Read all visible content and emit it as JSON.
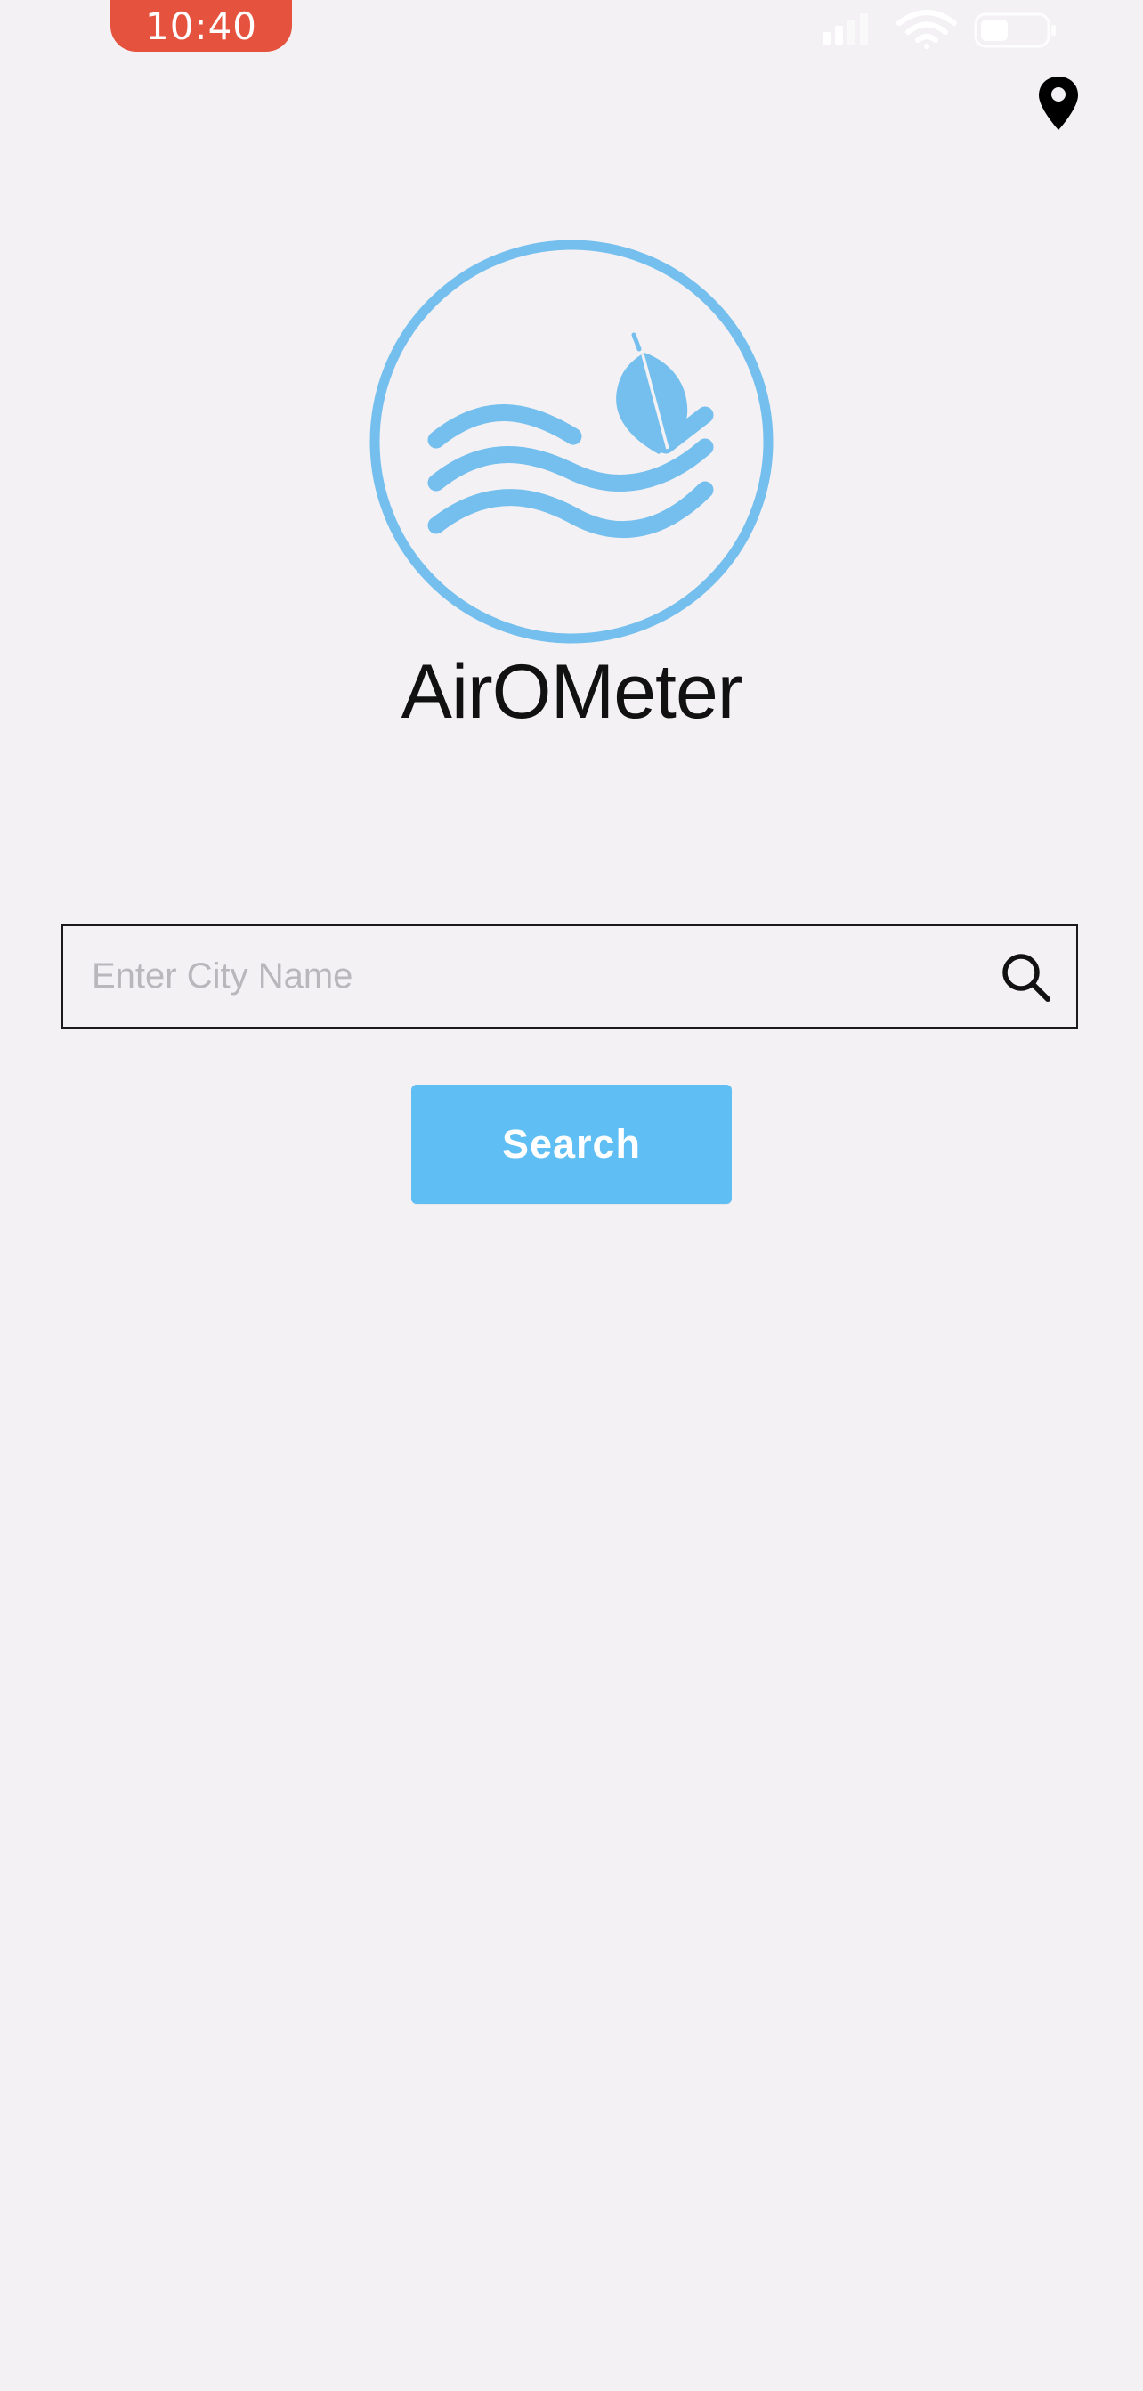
{
  "status_bar": {
    "time": "10:40",
    "time_pill_color": "#e5533f",
    "icons": [
      "cellular-signal-icon",
      "wifi-icon",
      "battery-icon"
    ]
  },
  "header": {
    "location_icon": "location-pin-icon"
  },
  "logo": {
    "icon": "air-waves-leaf-logo",
    "color": "#74bfee",
    "app_name": "AirOMeter"
  },
  "search": {
    "placeholder": "Enter City Name",
    "value": "",
    "icon": "search-icon",
    "button_label": "Search",
    "button_color": "#5fbef4"
  }
}
